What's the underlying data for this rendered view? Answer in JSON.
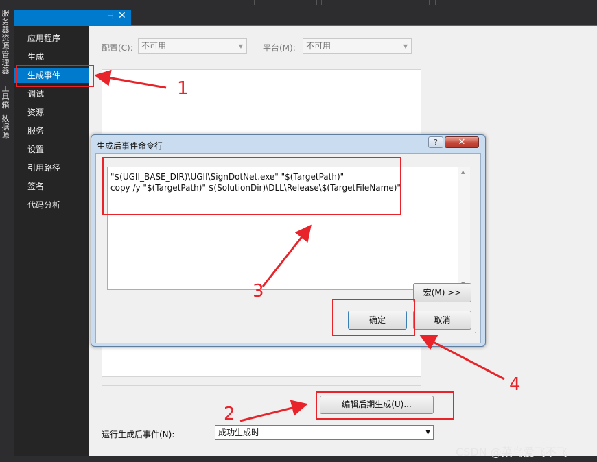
{
  "nav": {
    "items": [
      "应用程序",
      "生成",
      "生成事件",
      "调试",
      "资源",
      "服务",
      "设置",
      "引用路径",
      "签名",
      "代码分析"
    ],
    "selected_index": 2
  },
  "side_strip": {
    "labels": [
      "服务器资源管理器",
      "工具箱",
      "数据源"
    ]
  },
  "tab": {
    "pin_glyph": "⊣",
    "close_glyph": "✕"
  },
  "config": {
    "label": "配置(C):",
    "value": "不可用"
  },
  "platform": {
    "label": "平台(M):",
    "value": "不可用"
  },
  "edit_postbuild_button": "编辑后期生成(U)...",
  "run_postbuild": {
    "label": "运行生成后事件(N):",
    "value": "成功生成时"
  },
  "dialog": {
    "title": "生成后事件命令行",
    "help": "?",
    "close": "✕",
    "lines": [
      "\"$(UGII_BASE_DIR)\\UGII\\SignDotNet.exe\" \"$(TargetPath)\"",
      "copy /y \"$(TargetPath)\" $(SolutionDir)\\DLL\\Release\\$(TargetFileName)\""
    ],
    "macro_button": "宏(M) >>",
    "ok_button": "确定",
    "cancel_button": "取消"
  },
  "annotations": {
    "numbers": [
      "1",
      "2",
      "3",
      "4"
    ],
    "color": "#e8232a"
  },
  "watermark": "CSDN @菜鸟爱飞不飞"
}
